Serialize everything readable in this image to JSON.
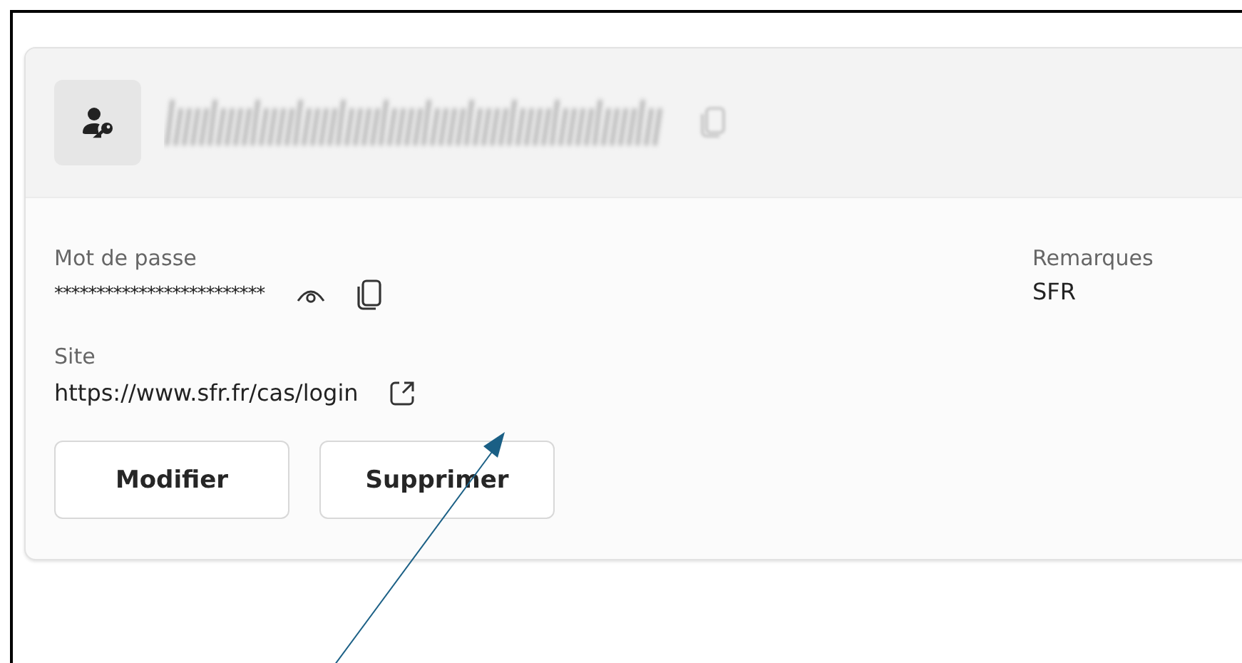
{
  "header": {
    "kind": "account"
  },
  "fields": [
    {
      "label": "Mot de passe",
      "value": "*************************",
      "kind": "password"
    },
    {
      "label": "Site",
      "value": "https://www.sfr.fr/cas/login",
      "kind": "link"
    }
  ],
  "notes": {
    "label": "Remarques",
    "value": "SFR"
  },
  "buttons": [
    "Modifier",
    "Supprimer"
  ]
}
